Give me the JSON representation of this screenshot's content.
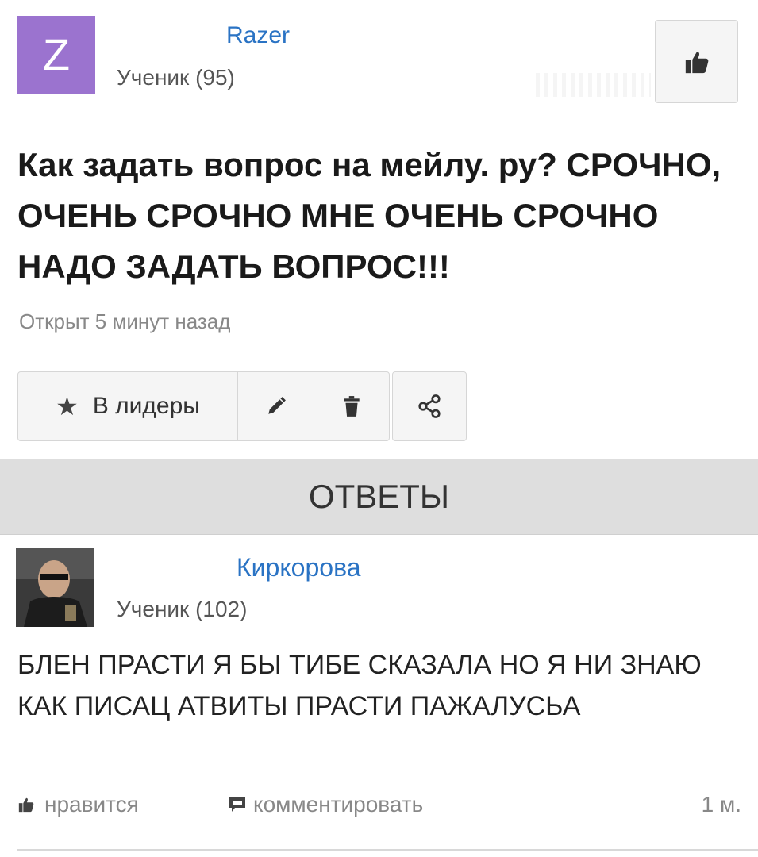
{
  "question": {
    "avatar_letter": "Z",
    "avatar_color": "#9b73cf",
    "author": "Razer",
    "rank": "Ученик (95)",
    "title": "Как задать вопрос на мейлу. ру? СРОЧНО, ОЧЕНЬ СРОЧНО МНЕ ОЧЕНЬ СРОЧНО НАДО ЗАДАТЬ ВОПРОС!!!",
    "opened": "Открыт 5 минут назад",
    "like_icon": "thumbs-up-icon"
  },
  "actions": {
    "leader_label": "В лидеры",
    "leader_icon": "star-icon",
    "edit_icon": "pencil-icon",
    "delete_icon": "trash-icon",
    "share_icon": "share-icon"
  },
  "answers_header": "ОТВЕТЫ",
  "answer": {
    "author": "Киркорова",
    "rank": "Ученик (102)",
    "text": "БЛЕН ПРАСТИ Я БЫ ТИБЕ СКАЗАЛА НО Я НИ ЗНАЮ КАК ПИСАЦ АТВИТЫ ПРАСТИ ПАЖАЛУСЬА",
    "like_label": "нравится",
    "comment_label": "комментировать",
    "time": "1 м."
  },
  "colors": {
    "link": "#2a73c4",
    "muted": "#888888",
    "banner_bg": "#dedede"
  }
}
